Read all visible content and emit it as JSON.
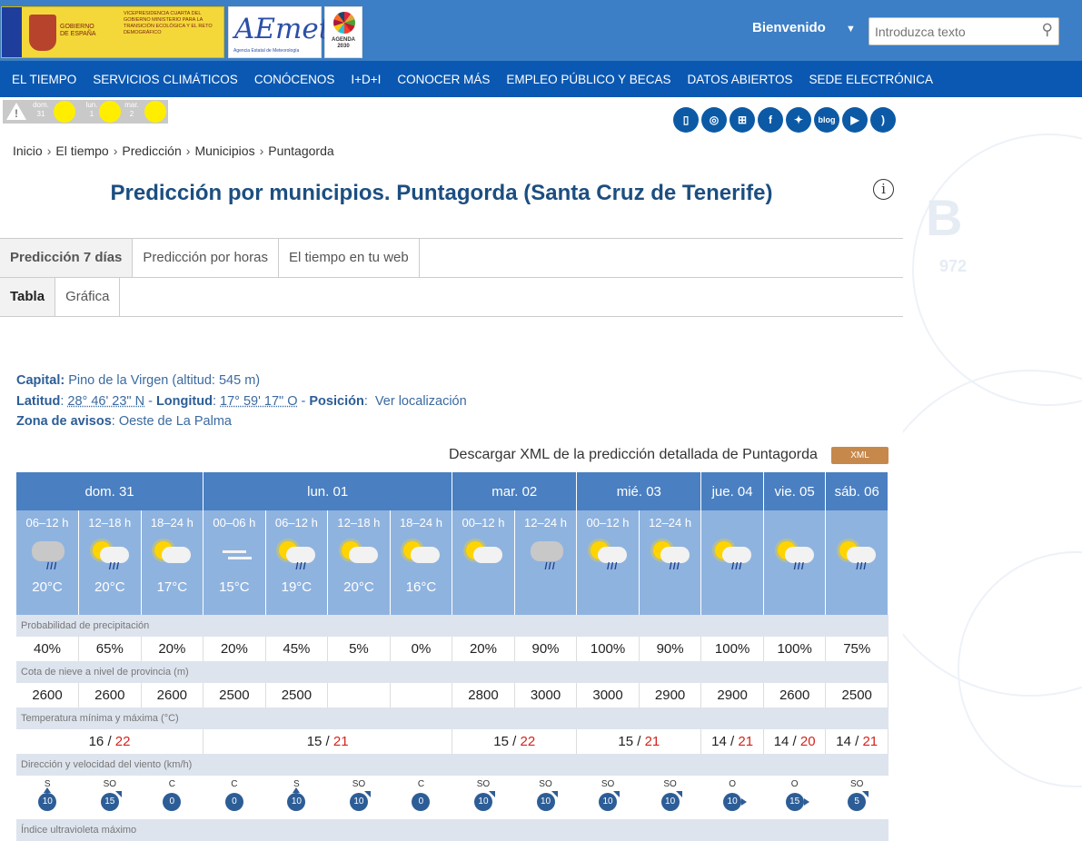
{
  "header": {
    "gov_label": "GOBIERNO DE ESPAÑA",
    "ministry_label": "VICEPRESIDENCIA CUARTA DEL GOBIERNO MINISTERIO PARA LA TRANSICIÓN ECOLÓGICA Y EL RETO DEMOGRÁFICO",
    "aemet_logo": "AEmet",
    "aemet_sub": "Agencia Estatal de Meteorología",
    "agenda_label": "AGENDA 2030",
    "welcome": "Bienvenido",
    "search_placeholder": "Introduzca texto"
  },
  "nav": [
    "EL TIEMPO",
    "SERVICIOS CLIMÁTICOS",
    "CONÓCENOS",
    "I+D+I",
    "CONOCER MÁS",
    "EMPLEO PÚBLICO Y BECAS",
    "DATOS ABIERTOS",
    "SEDE ELECTRÓNICA"
  ],
  "alerts": [
    {
      "day": "dom.",
      "num": "31"
    },
    {
      "day": "lun.",
      "num": "1"
    },
    {
      "day": "mar.",
      "num": "2"
    }
  ],
  "social": [
    "mobile-icon",
    "app-icon",
    "sitemap-icon",
    "facebook-icon",
    "twitter-icon",
    "blog-icon",
    "youtube-icon",
    "rss-icon"
  ],
  "social_labels": {
    "blog": "blog",
    "facebook": "f"
  },
  "breadcrumb": [
    "Inicio",
    "El tiempo",
    "Predicción",
    "Municipios",
    "Puntagorda"
  ],
  "page_title": "Predicción por municipios. Puntagorda (Santa Cruz de Tenerife)",
  "tabs_main": [
    "Predicción 7 días",
    "Predicción por horas",
    "El tiempo en tu web"
  ],
  "tabs_sub": [
    "Tabla",
    "Gráfica"
  ],
  "meta": {
    "capital_label": "Capital:",
    "capital_value": "Pino de la Virgen (altitud: 545 m)",
    "lat_label": "Latitud",
    "lat_value": "28° 46' 23\" N",
    "lon_label": "Longitud",
    "lon_value": "17° 59' 17\" O",
    "pos_label": "Posición",
    "pos_link": "Ver localización",
    "zona_label": "Zona de avisos",
    "zona_value": "Oeste de La Palma"
  },
  "xml": {
    "text": "Descargar XML de la predicción detallada de Puntagorda",
    "button": "XML"
  },
  "forecast": {
    "days": [
      {
        "label": "dom. 31",
        "span": 3
      },
      {
        "label": "lun. 01",
        "span": 4
      },
      {
        "label": "mar. 02",
        "span": 2
      },
      {
        "label": "mié. 03",
        "span": 2
      },
      {
        "label": "jue. 04",
        "span": 1
      },
      {
        "label": "vie. 05",
        "span": 1
      },
      {
        "label": "sáb. 06",
        "span": 1
      }
    ],
    "periods": [
      {
        "p": "06–12 h",
        "icon": "cloud-rain-icon",
        "t": "20°C"
      },
      {
        "p": "12–18 h",
        "icon": "sun-cloud-rain-icon",
        "t": "20°C"
      },
      {
        "p": "18–24 h",
        "icon": "sun-cloud-icon",
        "t": "17°C"
      },
      {
        "p": "00–06 h",
        "icon": "fog-icon",
        "t": "15°C"
      },
      {
        "p": "06–12 h",
        "icon": "sun-cloud-rain-icon",
        "t": "19°C"
      },
      {
        "p": "12–18 h",
        "icon": "sun-cloud-icon",
        "t": "20°C"
      },
      {
        "p": "18–24 h",
        "icon": "sun-cloud-icon",
        "t": "16°C"
      },
      {
        "p": "00–12 h",
        "icon": "sun-cloud-icon",
        "t": ""
      },
      {
        "p": "12–24 h",
        "icon": "cloud-rain-icon",
        "t": ""
      },
      {
        "p": "00–12 h",
        "icon": "sun-cloud-rain-icon",
        "t": ""
      },
      {
        "p": "12–24 h",
        "icon": "sun-cloud-rain-icon",
        "t": ""
      },
      {
        "p": "",
        "icon": "sun-cloud-rain-icon",
        "t": ""
      },
      {
        "p": "",
        "icon": "sun-cloud-rain-icon",
        "t": ""
      },
      {
        "p": "",
        "icon": "sun-cloud-rain-icon",
        "t": ""
      }
    ],
    "precip_label": "Probabilidad de precipitación",
    "precip": [
      "40%",
      "65%",
      "20%",
      "20%",
      "45%",
      "5%",
      "0%",
      "20%",
      "90%",
      "100%",
      "90%",
      "100%",
      "100%",
      "75%"
    ],
    "snow_label": "Cota de nieve a nivel de provincia (m)",
    "snow": [
      "2600",
      "2600",
      "2600",
      "2500",
      "2500",
      "",
      "",
      "2800",
      "3000",
      "3000",
      "2900",
      "2900",
      "2600",
      "2500"
    ],
    "temp_label": "Temperatura mínima y máxima (°C)",
    "temps": [
      {
        "min": "16",
        "max": "22"
      },
      {
        "min": "15",
        "max": "21"
      },
      {
        "min": "15",
        "max": "22"
      },
      {
        "min": "15",
        "max": "21"
      },
      {
        "min": "14",
        "max": "21"
      },
      {
        "min": "14",
        "max": "20"
      },
      {
        "min": "14",
        "max": "21"
      }
    ],
    "wind_label": "Dirección y velocidad del viento (km/h)",
    "wind": [
      {
        "dir": "S",
        "v": "10",
        "arrow": "n"
      },
      {
        "dir": "SO",
        "v": "15",
        "arrow": "ne"
      },
      {
        "dir": "C",
        "v": "0",
        "arrow": ""
      },
      {
        "dir": "C",
        "v": "0",
        "arrow": ""
      },
      {
        "dir": "S",
        "v": "10",
        "arrow": "n"
      },
      {
        "dir": "SO",
        "v": "10",
        "arrow": "ne"
      },
      {
        "dir": "C",
        "v": "0",
        "arrow": ""
      },
      {
        "dir": "SO",
        "v": "10",
        "arrow": "ne"
      },
      {
        "dir": "SO",
        "v": "10",
        "arrow": "ne"
      },
      {
        "dir": "SO",
        "v": "10",
        "arrow": "ne"
      },
      {
        "dir": "SO",
        "v": "10",
        "arrow": "ne"
      },
      {
        "dir": "O",
        "v": "10",
        "arrow": "e"
      },
      {
        "dir": "O",
        "v": "15",
        "arrow": "e"
      },
      {
        "dir": "SO",
        "v": "5",
        "arrow": "ne"
      }
    ],
    "uv_label": "Índice ultravioleta máximo"
  },
  "colors": {
    "topbar": "#3c7fc6",
    "navbar": "#0a58b2",
    "day_header": "#4a7fc1",
    "period": "#8fb3df",
    "max_temp": "#d3231c"
  },
  "background": {
    "pressure_letter": "B",
    "pressure_value": "972"
  }
}
